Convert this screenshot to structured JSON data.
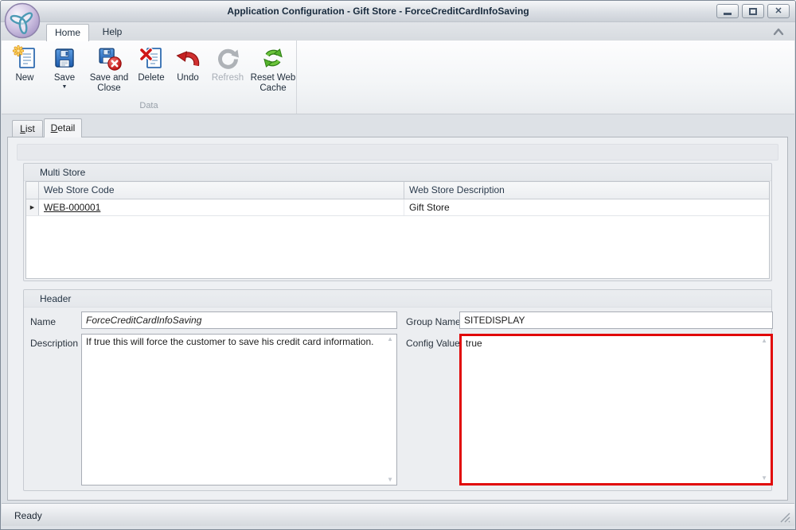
{
  "window": {
    "title": "Application Configuration - Gift Store - ForceCreditCardInfoSaving",
    "status": "Ready"
  },
  "ribbon": {
    "tabs": [
      {
        "label": "Home"
      },
      {
        "label": "Help"
      }
    ],
    "active_tab": "Home",
    "group": {
      "label": "Data",
      "buttons": [
        {
          "label": "New",
          "icon": "new-document-icon",
          "enabled": true
        },
        {
          "label": "Save",
          "icon": "save-icon",
          "enabled": true,
          "has_menu": true
        },
        {
          "label": "Save and Close",
          "icon": "save-and-close-icon",
          "enabled": true
        },
        {
          "label": "Delete",
          "icon": "delete-icon",
          "enabled": true
        },
        {
          "label": "Undo",
          "icon": "undo-icon",
          "enabled": true
        },
        {
          "label": "Refresh",
          "icon": "refresh-icon",
          "enabled": false
        },
        {
          "label": "Reset Web Cache",
          "icon": "reset-web-cache-icon",
          "enabled": true
        }
      ]
    }
  },
  "view_tabs": {
    "active": "Detail",
    "list": {
      "accel": "L",
      "rest": "ist"
    },
    "detail": {
      "accel": "D",
      "rest": "etail"
    }
  },
  "multi_store": {
    "title": "Multi Store",
    "columns": [
      "Web Store Code",
      "Web Store Description"
    ],
    "rows": [
      {
        "web_store_code": "WEB-000001",
        "web_store_description": "Gift Store"
      }
    ]
  },
  "header": {
    "title": "Header",
    "name_label": "Name",
    "name_value": "ForceCreditCardInfoSaving",
    "group_name_label": "Group Name",
    "group_name_value": "SITEDISPLAY",
    "description_label": "Description",
    "description_value": "If true this will force the customer to save his credit card information.",
    "config_value_label": "Config Value",
    "config_value": "true"
  },
  "colors": {
    "config_highlight_border": "#e10707",
    "accent_blue": "#2f6bb0",
    "disabled_text": "#a8aeb6",
    "ribbon_icon_green": "#55b32d",
    "ribbon_icon_red": "#c62222"
  }
}
